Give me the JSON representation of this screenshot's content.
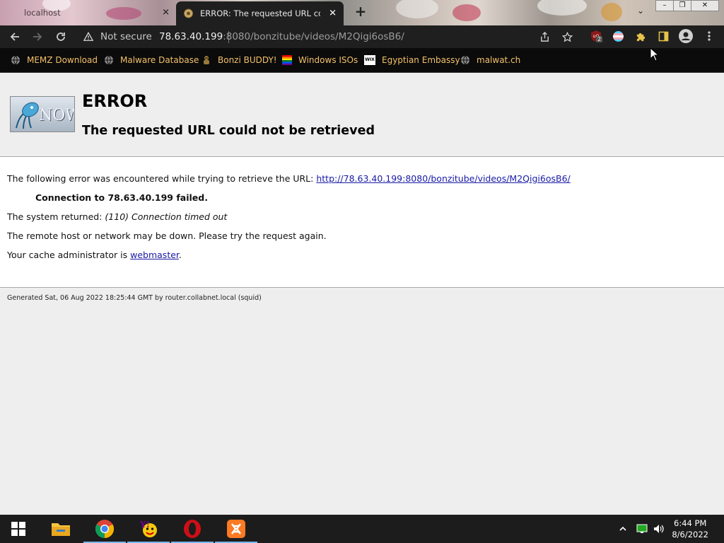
{
  "browser": {
    "tabs": [
      {
        "label": "localhost",
        "active": false
      },
      {
        "label": "ERROR: The requested URL could not be retrieved",
        "active": true
      }
    ],
    "new_tab_symbol": "+",
    "window_controls": {
      "minimize": "–",
      "restore": "❐",
      "close": "✕"
    },
    "address": {
      "security_label": "Not secure",
      "url_host": "78.63.40.199",
      "url_rest": ":8080/bonzitube/videos/M2Qigi6osB6/"
    },
    "extension_badge": "2",
    "bookmarks": [
      {
        "label": "MEMZ Download",
        "icon": "globe-icon"
      },
      {
        "label": "Malware Database",
        "icon": "globe-icon"
      },
      {
        "label": "Bonzi BUDDY!",
        "icon": "bonzi-icon"
      },
      {
        "label": "Windows ISOs",
        "icon": "rainbow-flag-icon"
      },
      {
        "label": "Egyptian Embassy",
        "icon": "wix-icon"
      },
      {
        "label": "malwat.ch",
        "icon": "globe-icon"
      }
    ],
    "colors": {
      "bookmark_text": "#f4c16a",
      "toolbar_bg": "#1f1f1f",
      "link": "#1a1aa6"
    }
  },
  "page": {
    "logo_text": "NOW",
    "title": "ERROR",
    "subtitle": "The requested URL could not be retrieved",
    "line1_prefix": "The following error was encountered while trying to retrieve the URL: ",
    "line1_url": "http://78.63.40.199:8080/bonzitube/videos/M2Qigi6osB6/",
    "failure": "Connection to 78.63.40.199 failed.",
    "returned_prefix": "The system returned: ",
    "returned_value": "(110) Connection timed out",
    "remote_down": "The remote host or network may be down. Please try the request again.",
    "admin_prefix": "Your cache administrator is ",
    "admin_link": "webmaster",
    "admin_suffix": ".",
    "footer": "Generated Sat, 06 Aug 2022 18:25:44 GMT by router.collabnet.local (squid)"
  },
  "taskbar": {
    "apps": [
      "start",
      "file-explorer",
      "chrome",
      "yahoo-messenger",
      "opera",
      "xampp"
    ],
    "clock_time": "6:44 PM",
    "clock_date": "8/6/2022"
  }
}
